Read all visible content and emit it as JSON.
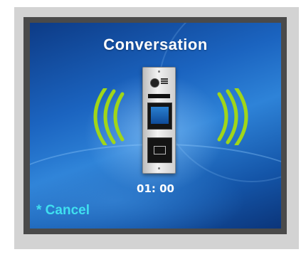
{
  "screen": {
    "title": "Conversation",
    "timer": "01: 00",
    "cancel_label": "* Cancel"
  },
  "icons": {
    "left_waves": "sound-waves-left-icon",
    "right_waves": "sound-waves-right-icon",
    "device": "door-station-panel-icon"
  },
  "colors": {
    "title": "#ffffff",
    "cancel": "#3fe0f0",
    "waves": "#9fd61a",
    "background": "#1b64c0"
  }
}
